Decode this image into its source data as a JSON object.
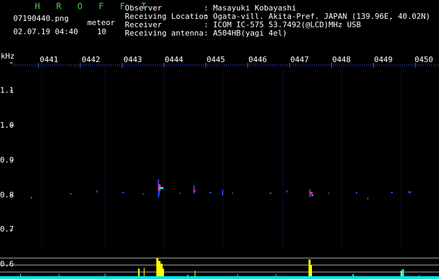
{
  "header": {
    "app_title": "H R O F F T",
    "filename": "07190440.png",
    "datetime": "02.07.19 04:40",
    "meteor_label": "meteor",
    "meteor_count": "10",
    "observer_label": "Observer",
    "observer_value": ": Masayuki Kobayashi",
    "location_label": "Receiving Location",
    "location_value": ": Ogata-vill. Akita-Pref. JAPAN (139.96E, 40.02N)",
    "receiver_label": "Receiver",
    "receiver_value": ": ICOM IC-575 53.7492(@LCD)MHz USB",
    "antenna_label": "Receiving antenna",
    "antenna_value": ": A504HB(yagi 4el)"
  },
  "axes": {
    "y_unit": "kHz",
    "time_ticks": [
      "0441",
      "0442",
      "0443",
      "0444",
      "0445",
      "0446",
      "0447",
      "0448",
      "0449",
      "0450"
    ],
    "freq_ticks": [
      "1.1",
      "1.0",
      "0.9",
      "0.8",
      "0.7",
      "0.6"
    ]
  },
  "colors": {
    "label_green": "#3fd23f",
    "trace_blue": "#1a2a8a",
    "meteor_yellow": "#ffff00",
    "baseline_cyan": "#00e5e5"
  }
}
